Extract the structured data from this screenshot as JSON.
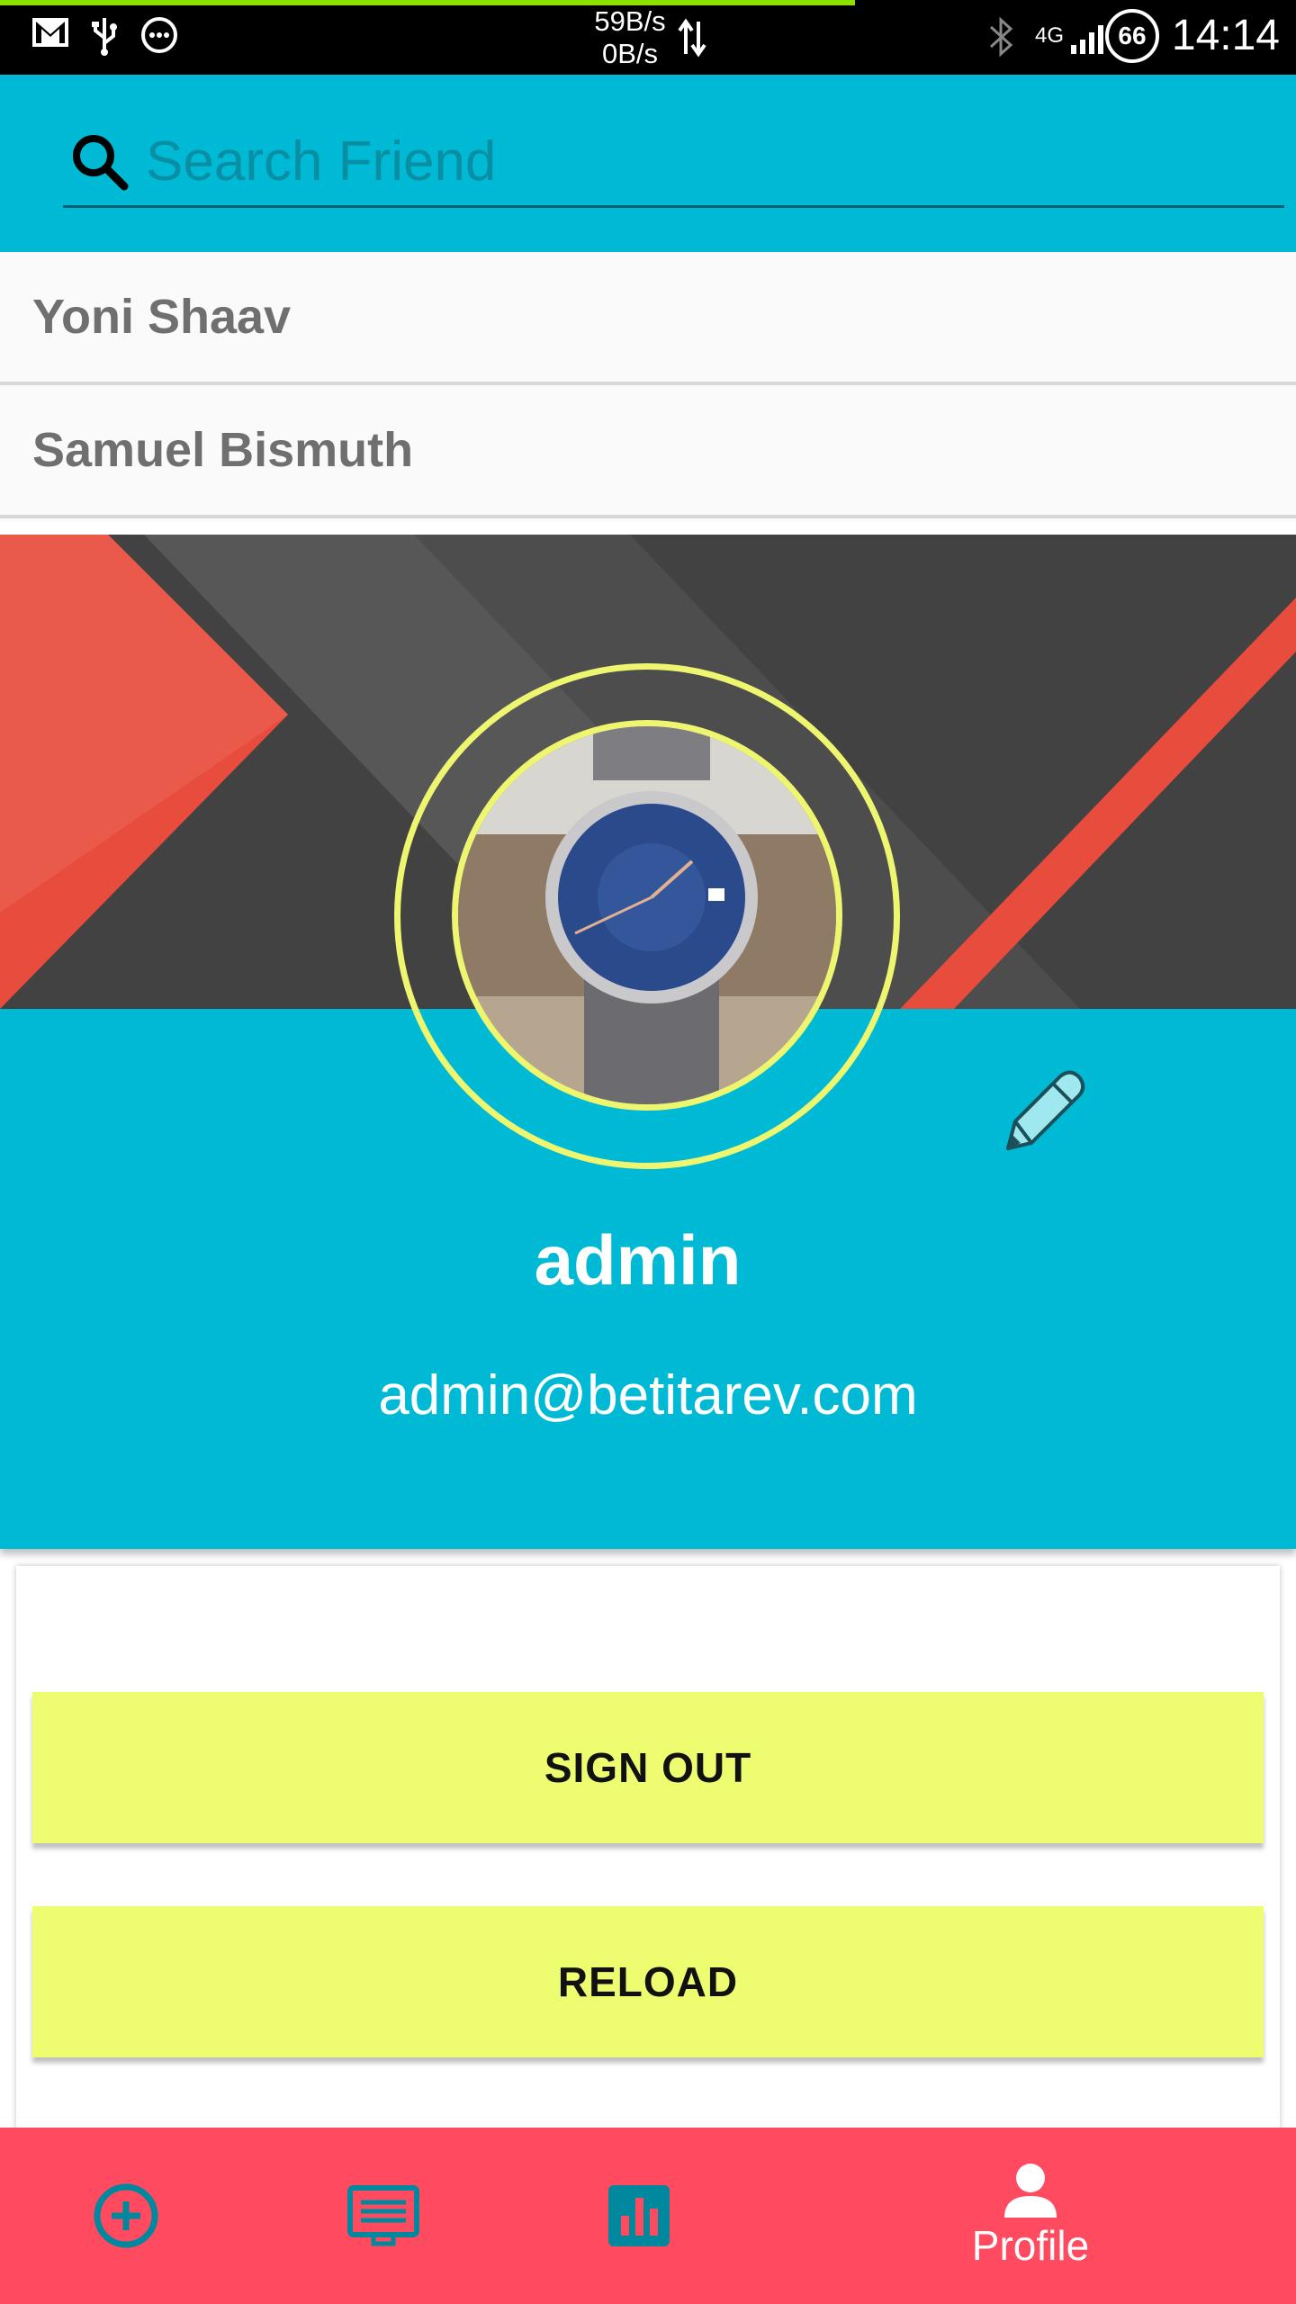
{
  "status_bar": {
    "net_up": "59B/s",
    "net_down": "0B/s",
    "network_type": "4G",
    "battery": "66",
    "time": "14:14"
  },
  "search": {
    "placeholder": "Search Friend",
    "icon": "search-icon"
  },
  "friends": [
    {
      "name": "Yoni Shaav"
    },
    {
      "name": "Samuel Bismuth"
    }
  ],
  "profile": {
    "username": "admin",
    "email": "admin@betitarev.com",
    "edit_icon": "pencil-icon"
  },
  "buttons": {
    "sign_out": "SIGN OUT",
    "reload": "RELOAD"
  },
  "bottom_nav": {
    "items": [
      {
        "icon": "add-circle-icon",
        "label": ""
      },
      {
        "icon": "list-icon",
        "label": ""
      },
      {
        "icon": "chart-icon",
        "label": ""
      },
      {
        "icon": "person-icon",
        "label": "Profile",
        "active": true
      }
    ]
  },
  "colors": {
    "primary": "#00b9d5",
    "accent": "#eefc70",
    "nav": "#ff4a5f",
    "banner_red": "#e84c3d"
  }
}
